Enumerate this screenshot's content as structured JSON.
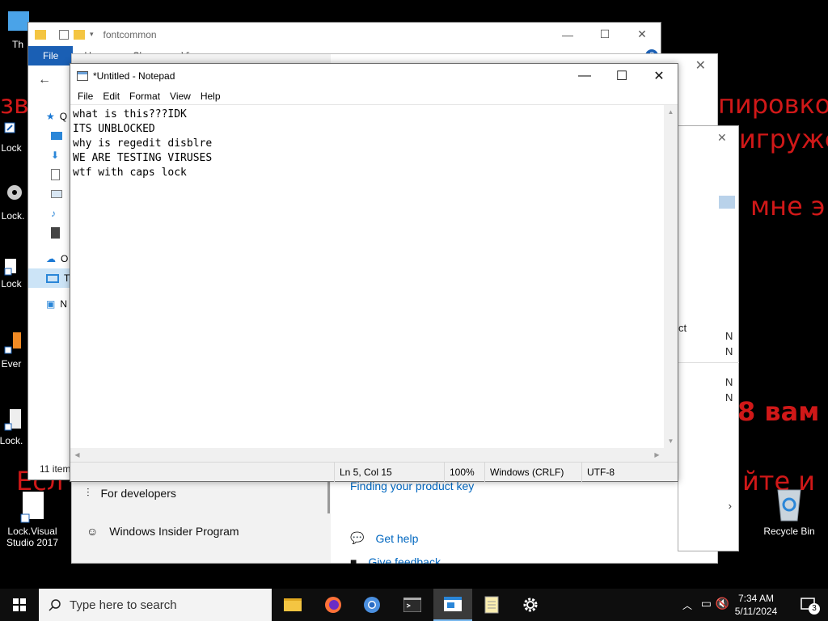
{
  "background_text": [
    "зв",
    "пировко",
    "игруже",
    "мне э",
    "8 вам",
    "йте и",
    "Есл"
  ],
  "desktop_icons": [
    "Th",
    "Lock",
    "Lock.",
    "Lock",
    "Ever",
    "Lock.",
    "Lock.Visual Studio 2017"
  ],
  "recycle_bin": "Recycle Bin",
  "explorer": {
    "title": "fontcommon",
    "ribbon": [
      "File",
      "Home",
      "Share",
      "View"
    ],
    "nav": [
      "Q",
      "",
      "",
      "",
      "",
      "",
      "O",
      "T",
      "N"
    ],
    "status": "11 item"
  },
  "settings": {
    "rows": [
      "For developers",
      "Windows Insider Program"
    ],
    "links": [
      "Finding your product key",
      "Get help",
      "Give feedback"
    ]
  },
  "midpanel": {
    "fragment": "ct",
    "letters": [
      "N",
      "N",
      "N",
      "N"
    ]
  },
  "notepad": {
    "title": "*Untitled - Notepad",
    "menu": [
      "File",
      "Edit",
      "Format",
      "View",
      "Help"
    ],
    "content": "what is this???IDK\nITS UNBLOCKED\nwhy is regedit disblre\nWE ARE TESTING VIRUSES\nwtf with caps lock",
    "status": {
      "position": "Ln 5, Col 15",
      "zoom": "100%",
      "line_ending": "Windows (CRLF)",
      "encoding": "UTF-8"
    }
  },
  "taskbar": {
    "search_placeholder": "Type here to search",
    "time": "7:34 AM",
    "date": "5/11/2024",
    "notifications": "3"
  },
  "colors": {
    "background_text": "#d01818",
    "accent": "#1a5fb4",
    "link": "#0067c0"
  }
}
